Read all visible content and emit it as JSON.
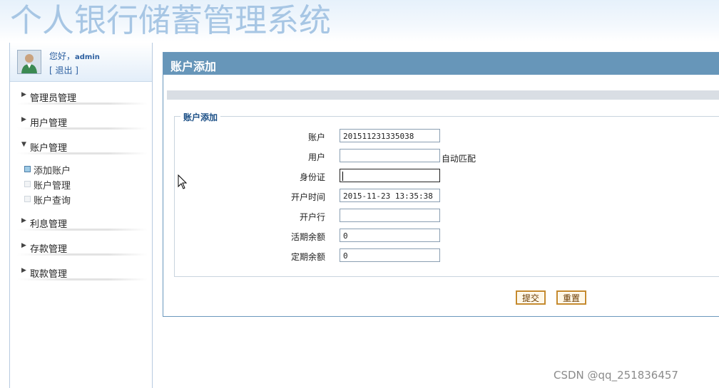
{
  "app": {
    "title": "个人银行储蓄管理系统"
  },
  "user": {
    "greeting": "您好，",
    "name": "admin",
    "logout": "[ 退出 ]"
  },
  "sidebar": {
    "groups": [
      {
        "label": "管理员管理",
        "arrow": "▶"
      },
      {
        "label": "用户管理",
        "arrow": "▶"
      },
      {
        "label": "账户管理",
        "arrow": "▼"
      },
      {
        "label": "利息管理",
        "arrow": "▶"
      },
      {
        "label": "存款管理",
        "arrow": "▶"
      },
      {
        "label": "取款管理",
        "arrow": "▶"
      }
    ],
    "account_subitems": [
      {
        "label": "添加账户",
        "active": true
      },
      {
        "label": "账户管理",
        "active": false
      },
      {
        "label": "账户查询",
        "active": false
      }
    ]
  },
  "panel": {
    "title": "账户添加",
    "legend": "账户添加",
    "fields": [
      {
        "label": "账户",
        "value": "201511231335038"
      },
      {
        "label": "用户",
        "value": "",
        "hint": "自动匹配"
      },
      {
        "label": "身份证",
        "value": ""
      },
      {
        "label": "开户时间",
        "value": "2015-11-23 13:35:38"
      },
      {
        "label": "开户行",
        "value": ""
      },
      {
        "label": "活期余额",
        "value": "0"
      },
      {
        "label": "定期余额",
        "value": "0"
      }
    ],
    "buttons": {
      "submit": "提交",
      "reset": "重置"
    }
  },
  "watermark": "CSDN @qq_251836457",
  "colors": {
    "header": "#6796b9",
    "banner_text": "#a7c6e4",
    "button_border": "#c58a2d"
  }
}
